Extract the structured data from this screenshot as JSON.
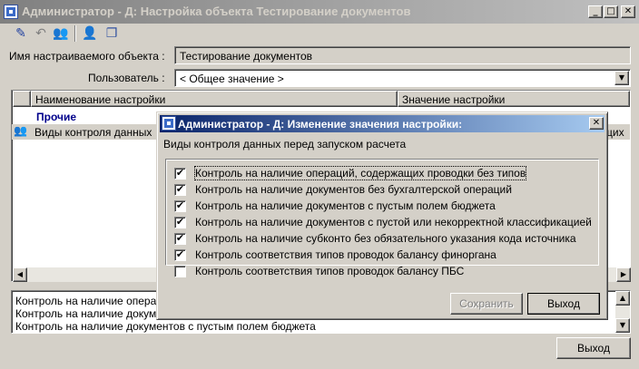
{
  "main": {
    "title": "Администратор - Д: Настройка объекта Тестирование документов",
    "controls": {
      "min": "_",
      "max": "□",
      "close": "✕"
    },
    "toolbar": [
      {
        "name": "edit-icon",
        "glyph": "✎"
      },
      {
        "name": "undo-icon",
        "glyph": "↶"
      },
      {
        "name": "users-icon",
        "glyph": "👥"
      },
      {
        "name": "user-icon",
        "glyph": "👤"
      },
      {
        "name": "copy-icon",
        "glyph": "❐"
      }
    ],
    "object_label": "Имя настраиваемого объекта :",
    "object_value": "Тестирование документов",
    "user_label": "Пользователь :",
    "user_value": "< Общее значение >",
    "grid": {
      "col1": "Наименование настройки",
      "col2": "Значение настройки",
      "group": "Прочие",
      "row_name": "Виды контроля данных",
      "row_value": "щих"
    },
    "desc_lines": [
      "Контроль на наличие опера",
      "Контроль на наличие докум",
      "Контроль на наличие документов с пустым полем бюджета"
    ],
    "exit_button": "Выход"
  },
  "dialog": {
    "title": "Администратор - Д:  Изменение значения настройки:",
    "close": "✕",
    "caption": "Виды контроля данных перед запуском расчета",
    "items": [
      {
        "label": "Контроль на наличие операций, содержащих проводки без типов",
        "checked": "✔"
      },
      {
        "label": "Контроль на наличие документов без бухгалтерской операций",
        "checked": "✔"
      },
      {
        "label": "Контроль на наличие документов с пустым полем бюджета",
        "checked": "✔"
      },
      {
        "label": "Контроль на наличие документов с пустой или некорректной классификацией",
        "checked": "✔"
      },
      {
        "label": "Контроль на наличие субконто без обязательного указания  кода источника",
        "checked": "✔"
      },
      {
        "label": "Контроль соответствия типов проводок балансу финоргана",
        "checked": "✔"
      },
      {
        "label": "Контроль соответствия типов проводок балансу ПБС",
        "checked": ""
      }
    ],
    "save_button": "Сохранить",
    "exit_button": "Выход"
  }
}
